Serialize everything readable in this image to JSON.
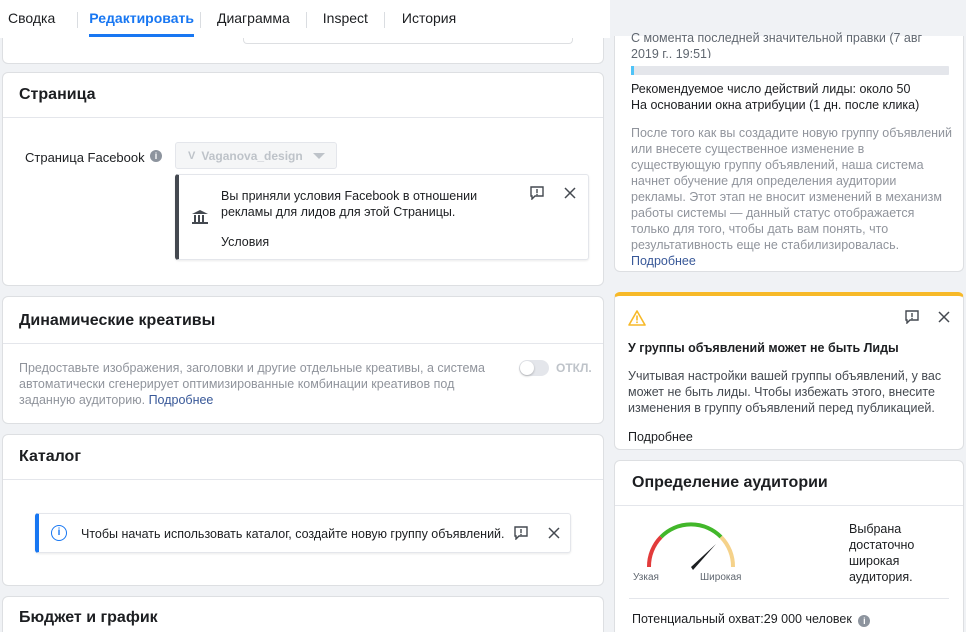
{
  "tabs": [
    {
      "label": "Сводка"
    },
    {
      "label": "Редактировать"
    },
    {
      "label": "Диаграмма"
    },
    {
      "label": "Inspect"
    },
    {
      "label": "История"
    }
  ],
  "page_section": {
    "title": "Страница",
    "fb_page_label": "Страница Facebook",
    "page_selector_value": "Vaganova_design",
    "notice_text": "Вы приняли условия Facebook в отношении рекламы для лидов для этой Страницы.",
    "notice_link": "Условия"
  },
  "dynamic_section": {
    "title": "Динамические креативы",
    "description": "Предоставьте изображения, заголовки и другие отдельные креативы, а система автоматически сгенерирует оптимизированные комбинации креативов под заданную аудиторию.",
    "description_link": "Подробнее",
    "toggle_label": "ОТКЛ."
  },
  "catalog_section": {
    "title": "Каталог",
    "notice_text": "Чтобы начать использовать каталог, создайте новую группу объявлений."
  },
  "budget_section": {
    "title": "Бюджет и график"
  },
  "learning_panel": {
    "top_text": "С момента последней значительной правки (7 авг 2019 г., 19:51)",
    "progress_fraction": 0.01,
    "recommended": "Рекомендуемое число действий лиды: около 50",
    "attribution": "На основании окна атрибуции (1 дн. после клика)",
    "explanation": "После того как вы создадите новую группу объявлений или внесете существенное изменение в существующую группу объявлений, наша система начнет обучение для определения аудитории рекламы. Этот этап не вносит изменений в механизм работы системы — данный статус отображается только для того, чтобы дать вам понять, что результативность еще не стабилизировалась.",
    "explanation_link": "Подробнее"
  },
  "warning_panel": {
    "title": "У группы объявлений может не быть Лиды",
    "body": "Учитывая настройки вашей группы объявлений, у вас может не быть лиды. Чтобы избежать этого, внесите изменения в группу объявлений перед публикацией.",
    "link": "Подробнее",
    "accent_color": "#f7b928"
  },
  "audience_panel": {
    "title": "Определение аудитории",
    "gauge_left": "Узкая",
    "gauge_right": "Широкая",
    "summary": "Выбрана достаточно широкая аудитория.",
    "reach_label": "Потенциальный охват:",
    "reach_value": "29 000 человек"
  }
}
